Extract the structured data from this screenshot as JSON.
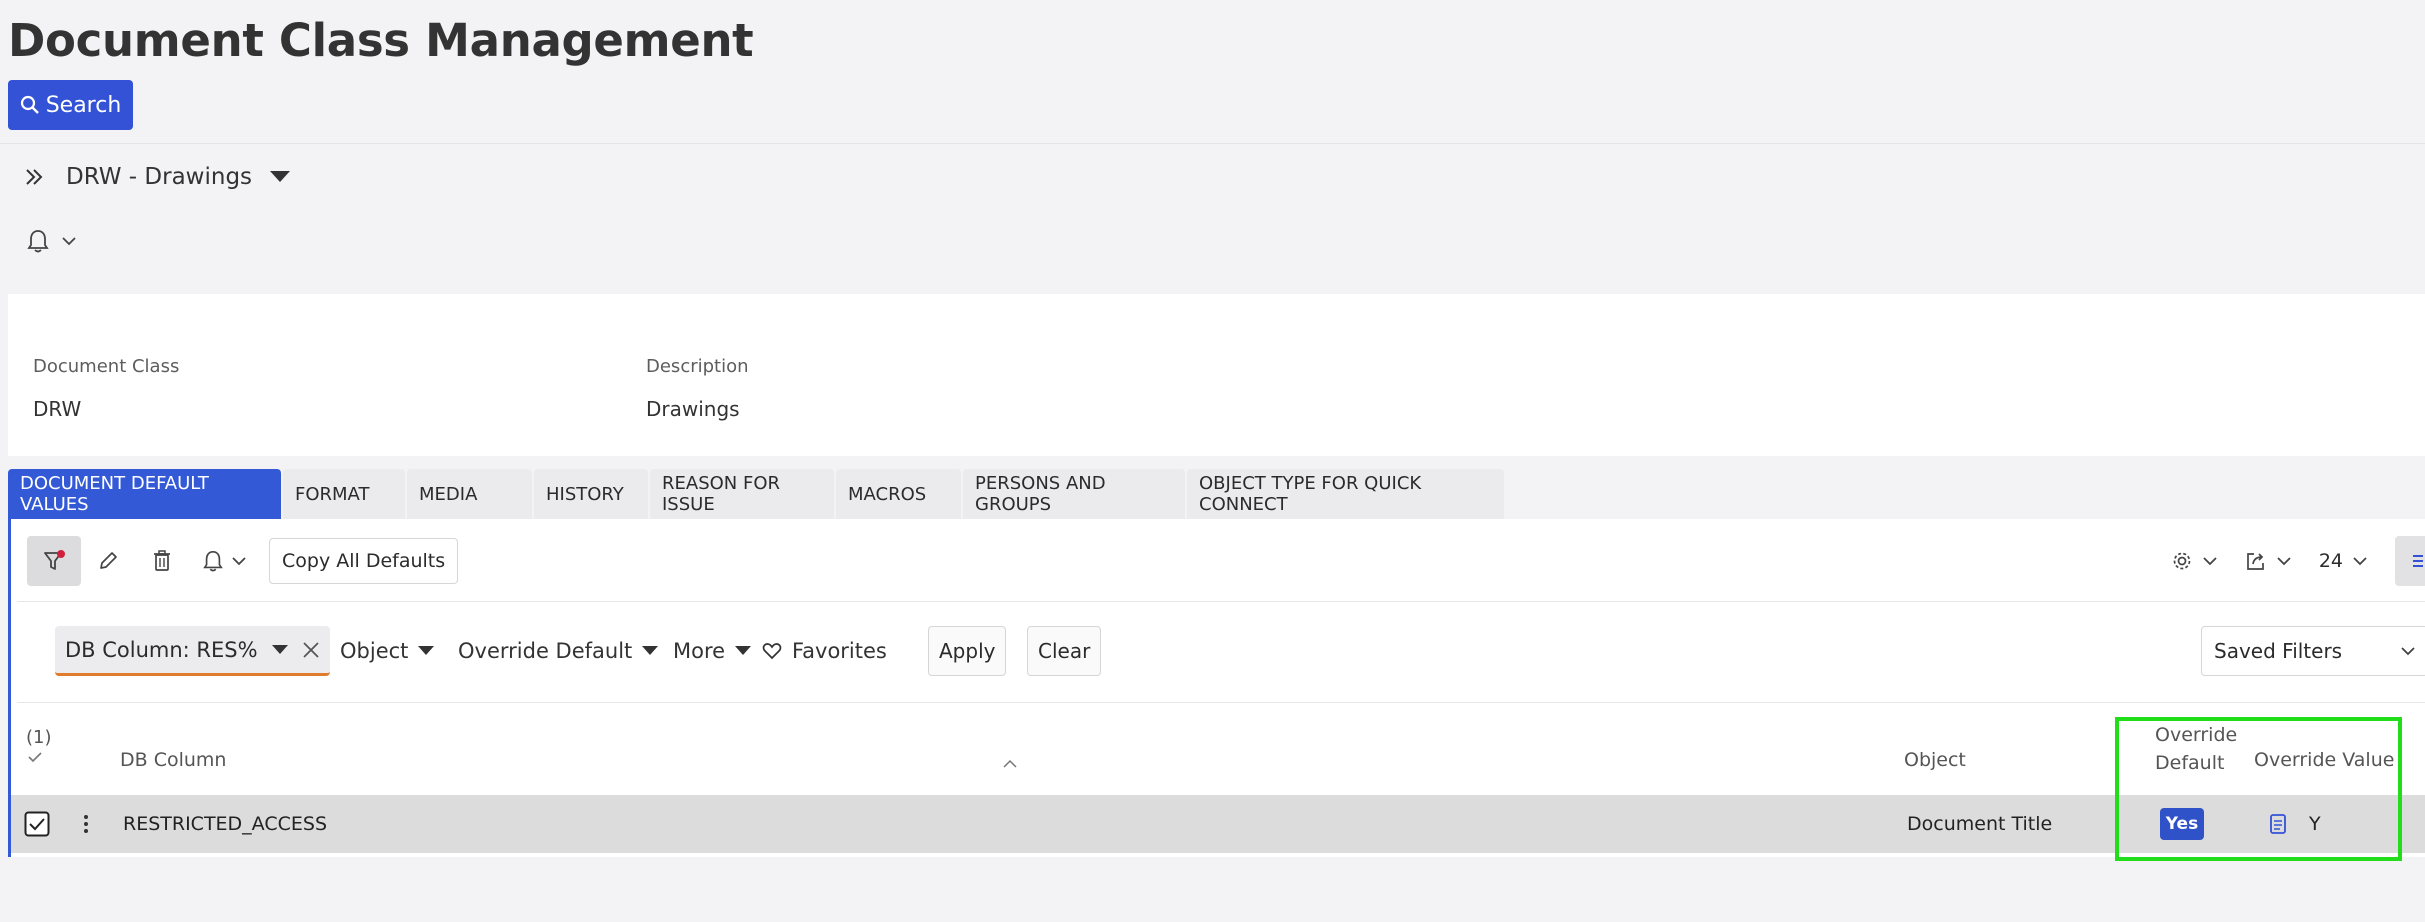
{
  "header": {
    "title": "Document Class Management",
    "search_label": "Search"
  },
  "record": {
    "selector_label": "DRW - Drawings"
  },
  "fields": {
    "document_class_label": "Document Class",
    "document_class_value": "DRW",
    "description_label": "Description",
    "description_value": "Drawings"
  },
  "tabs": [
    {
      "label": "DOCUMENT DEFAULT VALUES",
      "active": true
    },
    {
      "label": "FORMAT"
    },
    {
      "label": "MEDIA"
    },
    {
      "label": "HISTORY"
    },
    {
      "label": "REASON FOR ISSUE"
    },
    {
      "label": "MACROS"
    },
    {
      "label": "PERSONS AND GROUPS"
    },
    {
      "label": "OBJECT TYPE FOR QUICK CONNECT"
    }
  ],
  "toolbar": {
    "copy_label": "Copy All Defaults",
    "page_size": "24"
  },
  "filters": {
    "chip_label": "DB Column: RES%",
    "object_label": "Object",
    "override_default_label": "Override Default",
    "more_label": "More",
    "favorites_label": "Favorites",
    "apply_label": "Apply",
    "clear_label": "Clear",
    "saved_filters_label": "Saved Filters"
  },
  "table": {
    "selected_count": "(1)",
    "columns": {
      "db_column": "DB Column",
      "object": "Object",
      "override_default_line1": "Override",
      "override_default_line2": "Default",
      "override_value": "Override Value"
    },
    "rows": [
      {
        "db_column": "RESTRICTED_ACCESS",
        "object": "Document Title",
        "override_default": "Yes",
        "override_value": "Y"
      }
    ]
  },
  "colors": {
    "primary": "#3352d6",
    "highlight": "#22dd1a",
    "filter_accent": "#e07c2b"
  }
}
